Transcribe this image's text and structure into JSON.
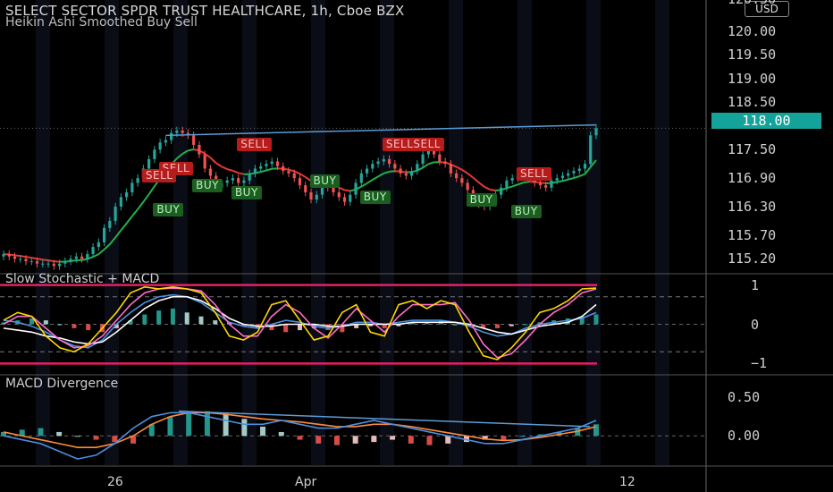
{
  "header": {
    "title": "SELECT SECTOR SPDR TRUST HEALTHCARE, 1h, Cboe BZX",
    "indicator": "Heikin Ashi Smoothed Buy Sell",
    "currency": "USD",
    "top_price_partial": "120.50"
  },
  "panes": {
    "stoch_title": "Slow Stochastic + MACD",
    "divergence_title": "MACD Divergence"
  },
  "colors": {
    "background": "#000000",
    "up_candle": "#26a69a",
    "down_candle": "#ef5350",
    "price_tag": "#14a39a",
    "sell_label": "#b71c1c",
    "buy_label": "#1b5e20",
    "trendline": "#5b9bd5",
    "smooth_up": "#22b14c",
    "smooth_down": "#e53935",
    "band": "#e91e63",
    "stoch_k": "#ffd600",
    "stoch_d": "#ff6ec7",
    "macd_line": "#4a90e2",
    "signal_line": "#ffffff"
  },
  "chart_data": [
    {
      "type": "candlestick",
      "title": "SELECT SECTOR SPDR TRUST HEALTHCARE, 1h, Cboe BZX",
      "subtitle": "Heikin Ashi Smoothed Buy Sell",
      "y_ticks": [
        "120.00",
        "119.50",
        "119.00",
        "118.50",
        "117.50",
        "116.90",
        "116.30",
        "115.70",
        "115.20"
      ],
      "y_tick_values": [
        120.0,
        119.5,
        119.0,
        118.5,
        117.5,
        116.9,
        116.3,
        115.7,
        115.2
      ],
      "ylim": [
        115.0,
        120.65
      ],
      "last_price": "118.00",
      "x_ticks": [
        "26",
        "Apr",
        "12"
      ],
      "close": [
        115.3,
        115.25,
        115.2,
        115.2,
        115.15,
        115.15,
        115.1,
        115.1,
        115.1,
        115.05,
        115.1,
        115.15,
        115.2,
        115.25,
        115.2,
        115.3,
        115.45,
        115.55,
        115.85,
        116.0,
        116.3,
        116.5,
        116.6,
        116.8,
        116.9,
        117.1,
        117.3,
        117.5,
        117.65,
        117.7,
        117.85,
        117.9,
        117.85,
        117.8,
        117.6,
        117.4,
        117.1,
        116.95,
        116.7,
        116.8,
        116.85,
        116.9,
        116.8,
        116.85,
        117.0,
        117.1,
        117.15,
        117.2,
        117.25,
        117.15,
        117.05,
        117.0,
        116.9,
        116.75,
        116.6,
        116.45,
        116.55,
        116.85,
        116.7,
        116.6,
        116.5,
        116.4,
        116.55,
        116.8,
        117.0,
        117.1,
        117.2,
        117.25,
        117.3,
        117.2,
        117.1,
        117.0,
        116.95,
        117.05,
        117.2,
        117.4,
        117.55,
        117.4,
        117.25,
        117.2,
        117.0,
        116.9,
        116.8,
        116.65,
        116.5,
        116.35,
        116.3,
        116.4,
        116.55,
        116.7,
        116.85,
        116.9,
        116.95,
        117.0,
        116.9,
        116.8,
        116.75,
        116.7,
        116.85,
        116.9,
        116.95,
        117.0,
        117.05,
        117.1,
        117.2,
        117.8,
        117.95
      ],
      "signals": [
        {
          "label": "SELL",
          "kind": "sell",
          "price": 117.62,
          "index": 44
        },
        {
          "label": "SELL",
          "kind": "sell",
          "price": 117.1,
          "index": 30
        },
        {
          "label": "SELL",
          "kind": "sell",
          "price": 116.95,
          "index": 27
        },
        {
          "label": "SELLSELL",
          "kind": "sell",
          "price": 117.62,
          "index": 70
        },
        {
          "label": "SELL",
          "kind": "sell",
          "price": 117.0,
          "index": 94
        },
        {
          "label": "BUY",
          "kind": "buy",
          "price": 116.75,
          "index": 36
        },
        {
          "label": "BUY",
          "kind": "buy",
          "price": 116.6,
          "index": 43
        },
        {
          "label": "BUY",
          "kind": "buy",
          "price": 116.25,
          "index": 29
        },
        {
          "label": "BUY",
          "kind": "buy",
          "price": 116.85,
          "index": 57
        },
        {
          "label": "BUY",
          "kind": "buy",
          "price": 116.5,
          "index": 66
        },
        {
          "label": "BUY",
          "kind": "buy",
          "price": 116.45,
          "index": 85
        },
        {
          "label": "BUY",
          "kind": "buy",
          "price": 116.2,
          "index": 93
        }
      ]
    },
    {
      "type": "line",
      "title": "Slow Stochastic + MACD",
      "y_ticks": [
        "1",
        "0",
        "−1"
      ],
      "y_tick_values": [
        1,
        0,
        -1
      ],
      "ylim": [
        -1.15,
        1.15
      ],
      "series": [
        {
          "key": "k",
          "values": [
            0.1,
            0.3,
            0.2,
            -0.3,
            -0.6,
            -0.7,
            -0.5,
            -0.1,
            0.3,
            0.8,
            0.95,
            0.9,
            0.95,
            0.9,
            0.8,
            0.3,
            -0.3,
            -0.4,
            -0.2,
            0.5,
            0.6,
            0.1,
            -0.4,
            -0.3,
            0.3,
            0.5,
            -0.2,
            -0.3,
            0.5,
            0.6,
            0.4,
            0.6,
            0.5,
            -0.2,
            -0.8,
            -0.9,
            -0.6,
            -0.2,
            0.3,
            0.4,
            0.6,
            0.9,
            0.92
          ]
        },
        {
          "key": "d",
          "values": [
            0.0,
            0.2,
            0.2,
            -0.1,
            -0.4,
            -0.6,
            -0.55,
            -0.3,
            0.1,
            0.5,
            0.8,
            0.9,
            0.92,
            0.9,
            0.85,
            0.5,
            0.0,
            -0.3,
            -0.3,
            0.2,
            0.5,
            0.3,
            -0.1,
            -0.35,
            0.0,
            0.4,
            0.1,
            -0.2,
            0.2,
            0.5,
            0.5,
            0.5,
            0.55,
            0.1,
            -0.5,
            -0.85,
            -0.75,
            -0.4,
            0.0,
            0.3,
            0.5,
            0.8,
            0.9
          ]
        },
        {
          "key": "macd",
          "values": [
            0.1,
            0.05,
            -0.05,
            -0.2,
            -0.4,
            -0.55,
            -0.6,
            -0.4,
            0.0,
            0.3,
            0.55,
            0.7,
            0.75,
            0.7,
            0.55,
            0.3,
            0.05,
            -0.05,
            -0.1,
            0.0,
            0.1,
            0.05,
            -0.05,
            -0.1,
            -0.05,
            0.05,
            0.05,
            0.0,
            0.05,
            0.1,
            0.1,
            0.1,
            0.05,
            -0.05,
            -0.2,
            -0.3,
            -0.25,
            -0.1,
            0.0,
            0.05,
            0.1,
            0.15,
            0.3
          ]
        },
        {
          "key": "signal",
          "values": [
            -0.1,
            -0.15,
            -0.2,
            -0.3,
            -0.35,
            -0.45,
            -0.5,
            -0.45,
            -0.2,
            0.1,
            0.4,
            0.6,
            0.7,
            0.7,
            0.6,
            0.4,
            0.15,
            0.0,
            -0.05,
            -0.05,
            0.0,
            0.0,
            0.0,
            -0.05,
            -0.05,
            0.0,
            0.0,
            0.0,
            0.0,
            0.05,
            0.05,
            0.05,
            0.05,
            0.0,
            -0.1,
            -0.2,
            -0.25,
            -0.15,
            -0.05,
            0.0,
            0.05,
            0.2,
            0.5
          ]
        },
        {
          "key": "hist",
          "values": [
            0.05,
            0.1,
            0.15,
            0.1,
            0.0,
            -0.1,
            -0.15,
            -0.2,
            -0.1,
            0.1,
            0.25,
            0.35,
            0.4,
            0.3,
            0.2,
            0.1,
            0.05,
            -0.05,
            -0.1,
            -0.15,
            -0.2,
            -0.15,
            -0.1,
            -0.15,
            -0.2,
            -0.1,
            -0.05,
            -0.1,
            -0.05,
            0.05,
            0.05,
            0.1,
            0.0,
            -0.05,
            -0.1,
            -0.1,
            -0.05,
            0.0,
            0.05,
            0.1,
            0.15,
            0.2,
            0.25
          ]
        }
      ]
    },
    {
      "type": "line",
      "title": "MACD Divergence",
      "y_ticks": [
        "0.50",
        "0.00"
      ],
      "y_tick_values": [
        0.5,
        0.0
      ],
      "ylim": [
        -0.38,
        0.78
      ],
      "series": [
        {
          "key": "macd",
          "values": [
            0.0,
            -0.05,
            -0.1,
            -0.2,
            -0.3,
            -0.25,
            -0.1,
            0.1,
            0.25,
            0.3,
            0.3,
            0.25,
            0.2,
            0.15,
            0.15,
            0.2,
            0.15,
            0.1,
            0.1,
            0.15,
            0.2,
            0.15,
            0.1,
            0.05,
            0.0,
            -0.05,
            -0.1,
            -0.1,
            -0.05,
            0.0,
            0.05,
            0.1,
            0.2
          ]
        },
        {
          "key": "signal",
          "values": [
            0.05,
            0.0,
            -0.05,
            -0.1,
            -0.15,
            -0.15,
            -0.1,
            0.0,
            0.15,
            0.25,
            0.3,
            0.3,
            0.28,
            0.25,
            0.22,
            0.2,
            0.18,
            0.15,
            0.12,
            0.12,
            0.15,
            0.15,
            0.12,
            0.08,
            0.04,
            0.0,
            -0.04,
            -0.06,
            -0.05,
            -0.02,
            0.02,
            0.06,
            0.12
          ]
        },
        {
          "key": "hist",
          "values": [
            0.05,
            0.08,
            0.1,
            0.05,
            0.0,
            -0.05,
            -0.08,
            -0.1,
            0.15,
            0.25,
            0.3,
            0.32,
            0.28,
            0.22,
            0.12,
            0.05,
            -0.05,
            -0.1,
            -0.12,
            -0.1,
            -0.08,
            -0.05,
            -0.1,
            -0.12,
            -0.1,
            -0.08,
            -0.05,
            -0.05,
            0.0,
            0.02,
            0.05,
            0.1,
            0.15
          ]
        }
      ]
    }
  ]
}
